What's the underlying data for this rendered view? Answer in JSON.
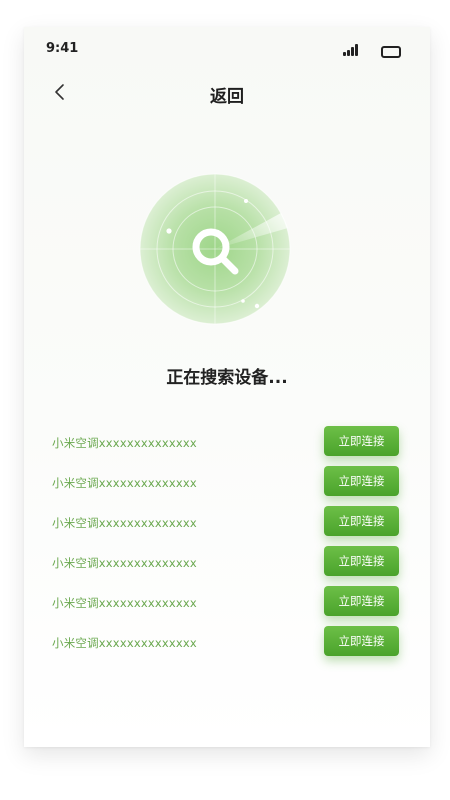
{
  "status_bar": {
    "time": "9:41"
  },
  "header": {
    "title": "返回"
  },
  "scan": {
    "status_text": "正在搜索设备..."
  },
  "devices": [
    {
      "name": "小米空调xxxxxxxxxxxxxx",
      "action": "立即连接"
    },
    {
      "name": "小米空调xxxxxxxxxxxxxx",
      "action": "立即连接"
    },
    {
      "name": "小米空调xxxxxxxxxxxxxx",
      "action": "立即连接"
    },
    {
      "name": "小米空调xxxxxxxxxxxxxx",
      "action": "立即连接"
    },
    {
      "name": "小米空调xxxxxxxxxxxxxx",
      "action": "立即连接"
    },
    {
      "name": "小米空调xxxxxxxxxxxxxx",
      "action": "立即连接"
    }
  ],
  "colors": {
    "accent": "#55ad34",
    "device_text": "#6aa84f",
    "title_text": "#1f1f1f"
  },
  "icons": {
    "back": "chevron-left-icon",
    "search": "magnifier-icon",
    "signal": "signal-bars-icon",
    "battery": "battery-icon"
  }
}
